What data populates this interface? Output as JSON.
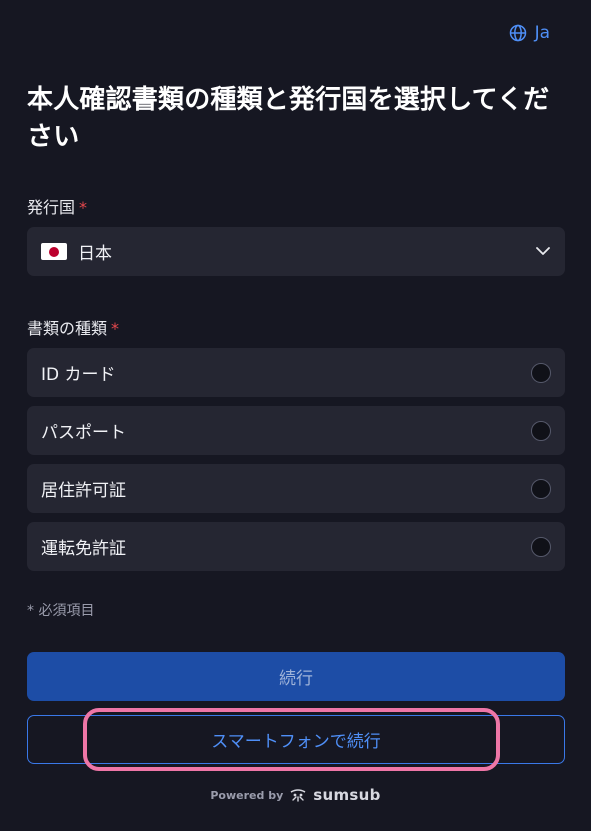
{
  "header": {
    "language": "Ja",
    "language_icon": "globe-icon"
  },
  "title": "本人確認書類の種類と発行国を選択してください",
  "country": {
    "label": "発行国",
    "required_mark": "*",
    "selected": "日本",
    "flag_icon": "japan-flag-icon",
    "dropdown_icon": "chevron-down-icon"
  },
  "document_type": {
    "label": "書類の種類",
    "required_mark": "*",
    "options": [
      {
        "label": "ID カード"
      },
      {
        "label": "パスポート"
      },
      {
        "label": "居住許可証"
      },
      {
        "label": "運転免許証"
      }
    ]
  },
  "required_note": "* 必須項目",
  "buttons": {
    "continue": "続行",
    "continue_on_phone": "スマートフォンで続行"
  },
  "footer": {
    "powered_by": "Powered by",
    "brand": "sumsub",
    "brand_icon": "sumsub-logo-icon"
  },
  "colors": {
    "background": "#161722",
    "accent": "#4f8ff7",
    "primary_button": "#1d4da6",
    "required": "#e5484d",
    "highlight": "#ee76a7"
  }
}
